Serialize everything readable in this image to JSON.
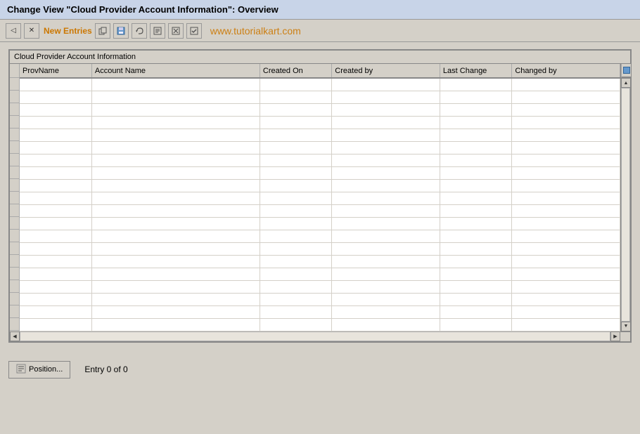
{
  "title_bar": {
    "text": "Change View \"Cloud Provider Account Information\": Overview"
  },
  "toolbar": {
    "new_entries_label": "New Entries",
    "watermark": "www.tutorialkart.com",
    "buttons": [
      {
        "name": "back-btn",
        "icon": "◁",
        "label": "Back"
      },
      {
        "name": "exit-btn",
        "icon": "⊠",
        "label": "Exit"
      },
      {
        "name": "new-entries-btn",
        "icon": "",
        "label": "New Entries"
      },
      {
        "name": "copy-btn",
        "icon": "⎘",
        "label": "Copy"
      },
      {
        "name": "save-btn",
        "icon": "💾",
        "label": "Save"
      },
      {
        "name": "undo-btn",
        "icon": "↩",
        "label": "Undo"
      },
      {
        "name": "details-btn",
        "icon": "≡",
        "label": "Details"
      },
      {
        "name": "delete-btn",
        "icon": "✕",
        "label": "Delete"
      },
      {
        "name": "select-btn",
        "icon": "☑",
        "label": "Select"
      }
    ]
  },
  "table": {
    "section_title": "Cloud Provider Account Information",
    "columns": [
      {
        "key": "prov_name",
        "label": "ProvName",
        "width": "10%"
      },
      {
        "key": "account_name",
        "label": "Account Name",
        "width": "28%"
      },
      {
        "key": "created_on",
        "label": "Created On",
        "width": "11%"
      },
      {
        "key": "created_by",
        "label": "Created by",
        "width": "18%"
      },
      {
        "key": "last_change",
        "label": "Last Change",
        "width": "11%"
      },
      {
        "key": "changed_by",
        "label": "Changed by",
        "width": "22%"
      }
    ],
    "rows": 20
  },
  "footer": {
    "position_btn_label": "Position...",
    "entry_count_label": "Entry 0 of 0"
  }
}
